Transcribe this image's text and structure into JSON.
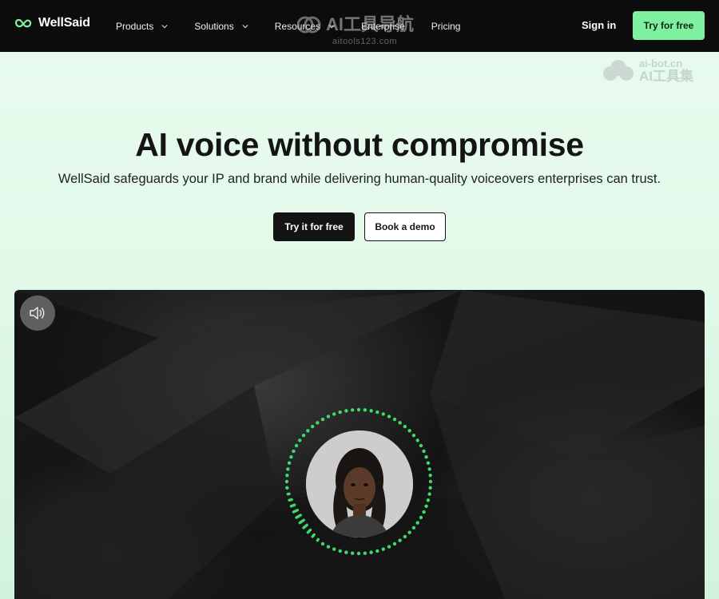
{
  "nav": {
    "brand": "WellSaid",
    "items": [
      {
        "label": "Products",
        "has_dropdown": true
      },
      {
        "label": "Solutions",
        "has_dropdown": true
      },
      {
        "label": "Resources",
        "has_dropdown": true
      },
      {
        "label": "Enterprise",
        "has_dropdown": false
      },
      {
        "label": "Pricing",
        "has_dropdown": false
      }
    ],
    "sign_in": "Sign in",
    "cta": "Try for free"
  },
  "hero": {
    "title": "AI voice without compromise",
    "subtitle": "WellSaid safeguards your IP and brand while delivering human-quality voiceovers enterprises can trust.",
    "primary_button": "Try it for free",
    "secondary_button": "Book a demo"
  },
  "video": {
    "mute_icon": "speaker-icon",
    "ring_color": "#3ddc6a"
  },
  "watermarks": {
    "wm1_main": "AI工具导航",
    "wm1_sub": "aitools123.com",
    "wm2_top": "ai-bot.cn",
    "wm2_main": "AI工具集"
  },
  "colors": {
    "accent": "#7ef0a0",
    "nav_bg": "#0c0c0c",
    "hero_bg": "#e6faee"
  }
}
